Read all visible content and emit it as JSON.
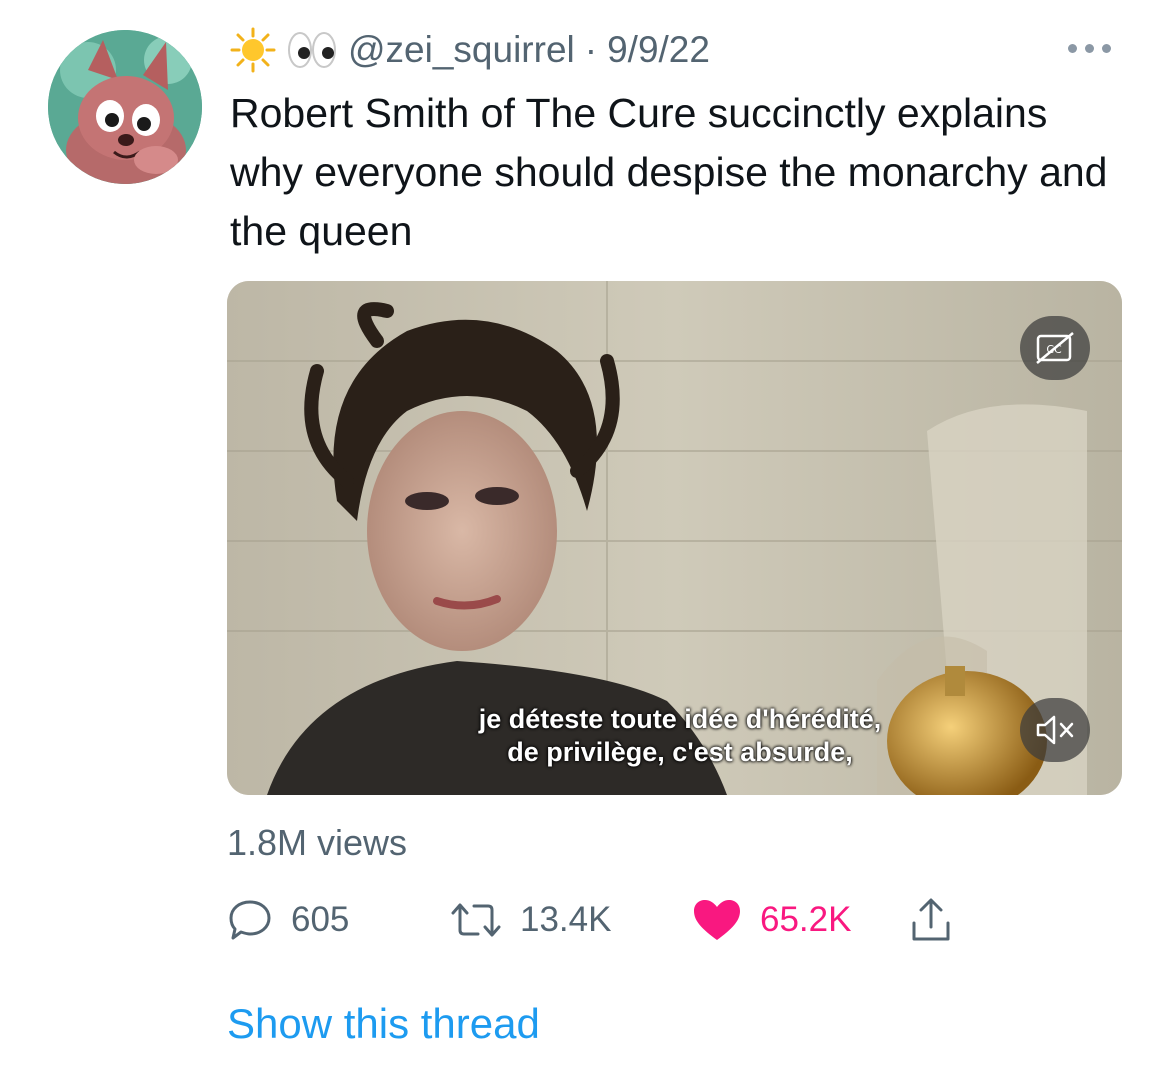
{
  "author": {
    "display_emojis": [
      "sun-emoji",
      "eyes-emoji"
    ],
    "handle": "@zei_squirrel",
    "separator": "·",
    "date": "9/9/22"
  },
  "tweet": {
    "text": "Robert Smith of The Cure succinctly explains why everyone should despise the monarchy and the queen"
  },
  "media": {
    "subtitle_line1": "je déteste toute idée d'hérédité,",
    "subtitle_line2": "de privilège, c'est absurde,",
    "cc_icon": "closed-captions-off-icon",
    "mute_icon": "speaker-muted-icon"
  },
  "stats": {
    "views": "1.8M views",
    "replies": "605",
    "retweets": "13.4K",
    "likes": "65.2K"
  },
  "links": {
    "show_thread": "Show this thread"
  },
  "colors": {
    "secondary_text": "#536471",
    "like_pink": "#f91880",
    "link_blue": "#1d9bf0"
  }
}
